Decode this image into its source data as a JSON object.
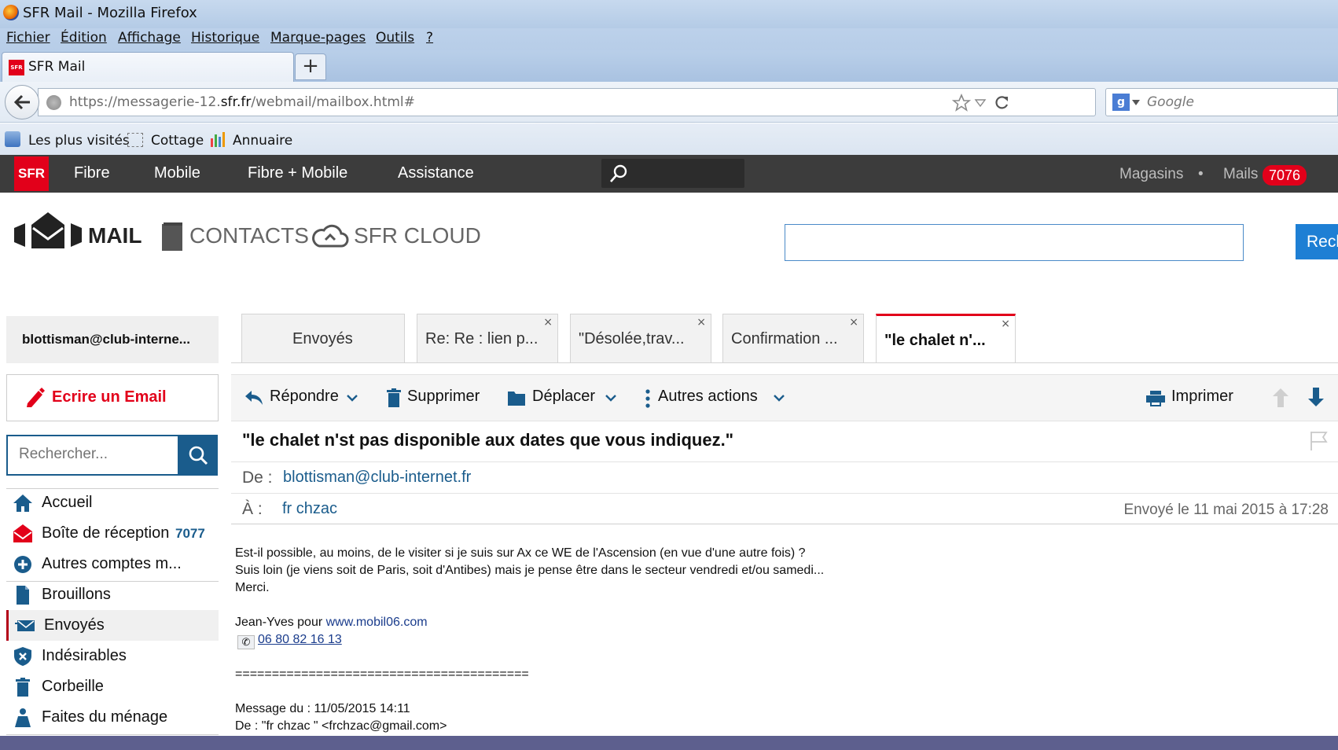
{
  "window": {
    "title": "SFR Mail - Mozilla Firefox"
  },
  "menu": [
    "Fichier",
    "Édition",
    "Affichage",
    "Historique",
    "Marque-pages",
    "Outils",
    "?"
  ],
  "browser_tab": {
    "label": "SFR Mail",
    "favicon_text": "SFR"
  },
  "address_bar": {
    "url_prefix": "https://messagerie-12.",
    "url_domain": "sfr.fr",
    "url_path": "/webmail/mailbox.html#"
  },
  "search_engine": {
    "placeholder": "Google"
  },
  "bookmarks": [
    "Les plus visités",
    "Cottage",
    "Annuaire"
  ],
  "sfr_nav": {
    "logo": "SFR",
    "items": [
      "Fibre",
      "Mobile",
      "Fibre + Mobile",
      "Assistance"
    ],
    "right": {
      "stores": "Magasins",
      "dot": "•",
      "mails": "Mails",
      "mails_count": "7076"
    }
  },
  "header": {
    "mail": "MAIL",
    "contacts": "CONTACTS",
    "cloud": "SFR CLOUD",
    "search_button": "Rech"
  },
  "sidebar": {
    "account": "blottisman@club-interne...",
    "compose": "Ecrire un Email",
    "search_placeholder": "Rechercher...",
    "folders": [
      {
        "label": "Accueil"
      },
      {
        "label": "Boîte de réception",
        "count": "7077"
      },
      {
        "label": "Autres comptes m..."
      },
      {
        "label": "Brouillons"
      },
      {
        "label": "Envoyés"
      },
      {
        "label": "Indésirables"
      },
      {
        "label": "Corbeille"
      },
      {
        "label": "Faites du ménage"
      }
    ]
  },
  "tabs": [
    {
      "label": "Envoyés"
    },
    {
      "label": "Re: Re : lien p...",
      "close": "×"
    },
    {
      "label": "\"Désolée,trav...",
      "close": "×"
    },
    {
      "label": "Confirmation ...",
      "close": "×"
    },
    {
      "label": "\"le chalet n'...",
      "close": "×"
    }
  ],
  "toolbar": {
    "reply": "Répondre",
    "delete": "Supprimer",
    "move": "Déplacer",
    "more": "Autres actions",
    "print": "Imprimer"
  },
  "message": {
    "subject": "\"le chalet n'st pas disponible aux dates que vous indiquez.\"",
    "from_label": "De :",
    "from": "blottisman@club-internet.fr",
    "to_label": "À :",
    "to": "fr chzac",
    "sent": "Envoyé le 11 mai 2015 à 17:28",
    "body": {
      "l1": "Est-il possible, au moins, de le visiter si je suis sur Ax ce WE de l'Ascension (en vue d'une autre fois) ?",
      "l2": "Suis loin (je viens soit de Paris, soit d'Antibes) mais je pense être dans le secteur vendredi et/ou samedi...",
      "l3": "Merci.",
      "sig_prefix": "Jean-Yves pour ",
      "sig_link": "www.mobil06.com",
      "phone": "06 80 82 16 13",
      "separator": "========================================",
      "quoted_date": "Message du : 11/05/2015 14:11",
      "quoted_from": "De : \"fr chzac \" <frchzac@gmail.com>"
    }
  },
  "colors": {
    "sfr_red": "#e2001a",
    "nav_dark": "#3c3c3c",
    "link_blue": "#1a5c8c",
    "primary_blue": "#1e7fd4"
  }
}
